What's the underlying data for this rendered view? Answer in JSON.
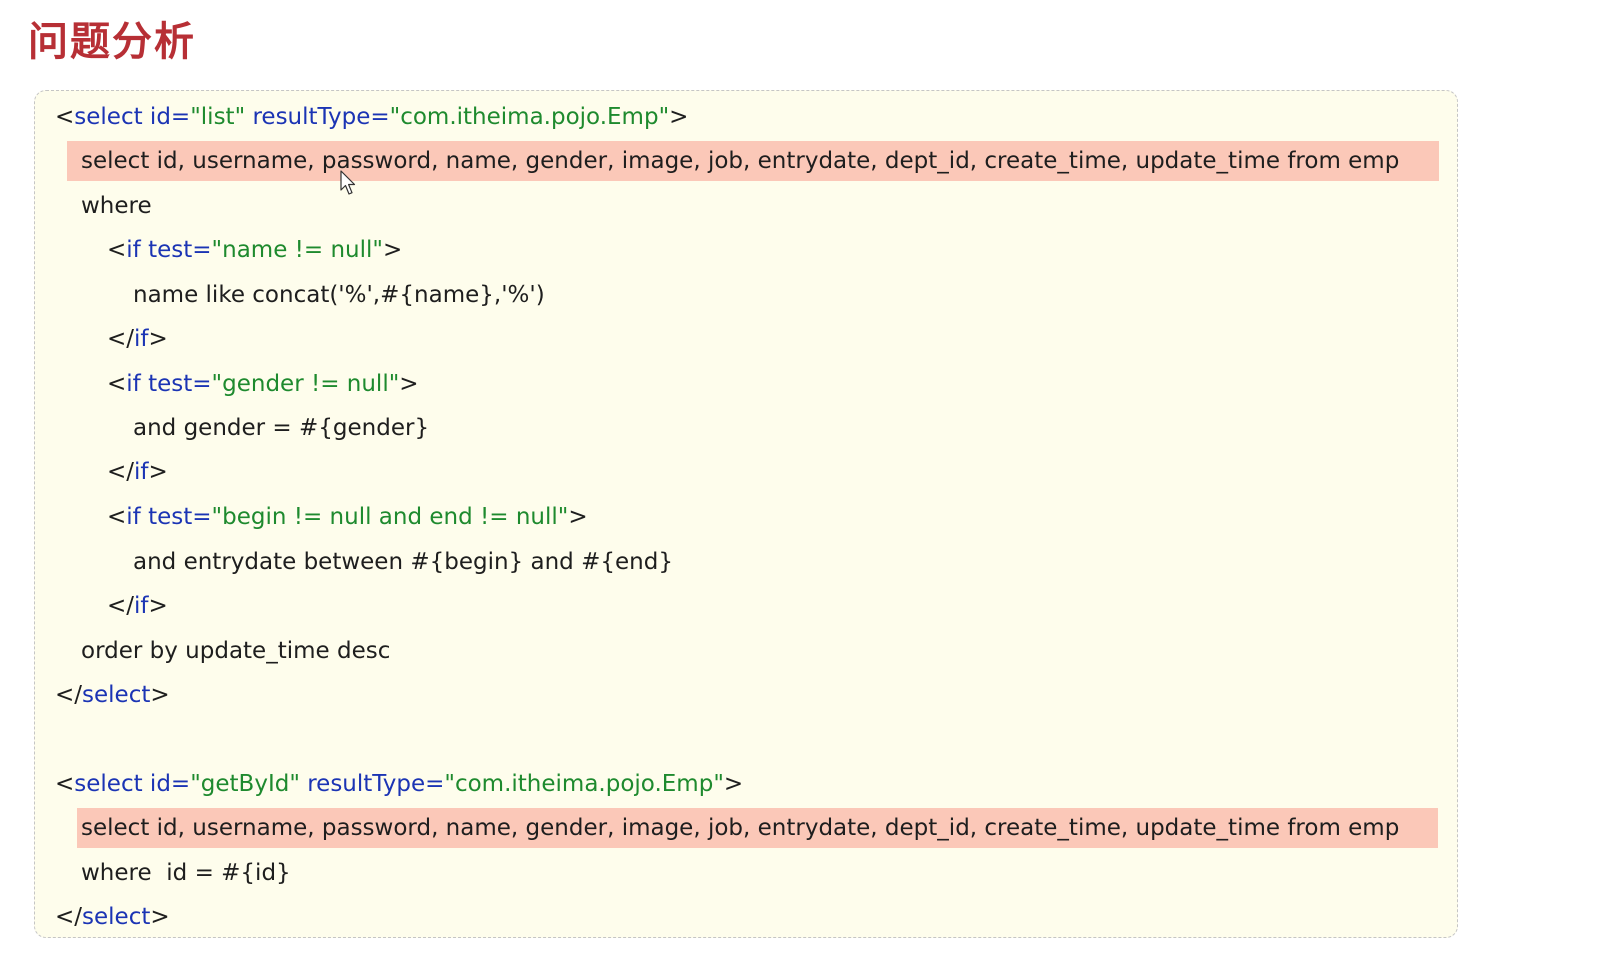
{
  "title": "问题分析",
  "colors": {
    "title": "#b72f35",
    "box_bg": "#fefdec",
    "highlight": "#fbc8b8",
    "keyword": "#1b34b4",
    "string": "#1e8a2e"
  },
  "code": {
    "select1_open": {
      "lt": "<",
      "tag": "select",
      "attr1": " id=",
      "val1": "\"list\"",
      "attr2": " resultType=",
      "val2": "\"com.itheima.pojo.Emp\"",
      "gt": ">"
    },
    "select1_sql": "select id, username, password, name, gender, image, job, entrydate, dept_id, create_time, update_time from emp",
    "where": "where",
    "if1_open": {
      "lt": "<",
      "tag": "if",
      "attr": " test=",
      "val": "\"name != null\"",
      "gt": ">"
    },
    "if1_body": "name like concat('%',#{name},'%')",
    "if1_close": {
      "lt": "</",
      "tag": "if",
      "gt": ">"
    },
    "if2_open": {
      "lt": "<",
      "tag": "if",
      "attr": " test=",
      "val": "\"gender != null\"",
      "gt": ">"
    },
    "if2_body": "and gender = #{gender}",
    "if2_close": {
      "lt": "</",
      "tag": "if",
      "gt": ">"
    },
    "if3_open": {
      "lt": "<",
      "tag": "if",
      "attr": " test=",
      "val": "\"begin != null and end != null\"",
      "gt": ">"
    },
    "if3_body": "and entrydate between #{begin} and #{end}",
    "if3_close": {
      "lt": "</",
      "tag": "if",
      "gt": ">"
    },
    "order_by": "order by update_time desc",
    "select1_close": {
      "lt": "</",
      "tag": "select",
      "gt": ">"
    },
    "select2_open": {
      "lt": "<",
      "tag": "select",
      "attr1": " id=",
      "val1": "\"getById\"",
      "attr2": " resultType=",
      "val2": "\"com.itheima.pojo.Emp\"",
      "gt": ">"
    },
    "select2_sql": "select id, username, password, name, gender, image, job, entrydate, dept_id, create_time, update_time from emp",
    "select2_where": "where  id = #{id}",
    "select2_close": {
      "lt": "</",
      "tag": "select",
      "gt": ">"
    }
  }
}
